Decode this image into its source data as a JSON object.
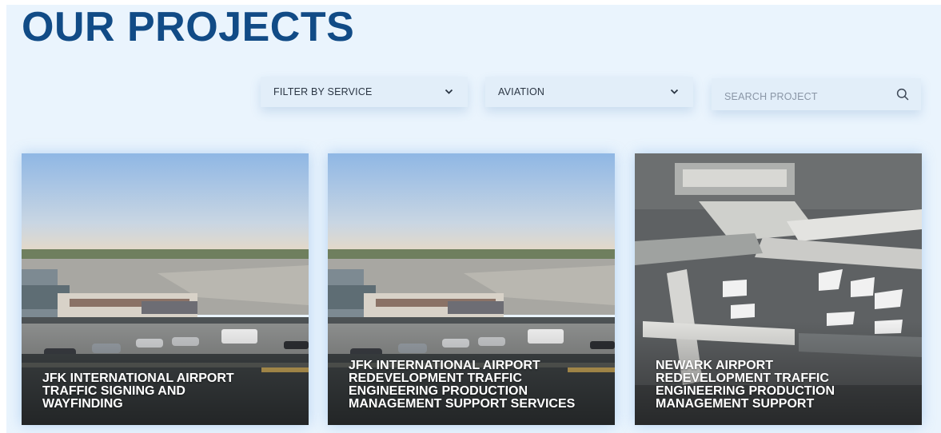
{
  "page": {
    "title": "OUR PROJECTS"
  },
  "filters": {
    "service": {
      "value": "FILTER BY SERVICE",
      "icon": "chevron-down-icon"
    },
    "category": {
      "value": "AVIATION",
      "icon": "chevron-down-icon"
    },
    "search": {
      "placeholder": "SEARCH PROJECT",
      "value": "",
      "icon": "search-icon"
    }
  },
  "projects": [
    {
      "title": "JFK INTERNATIONAL AIRPORT TRAFFIC SIGNING AND WAYFINDING"
    },
    {
      "title": "JFK INTERNATIONAL AIRPORT REDEVELOPMENT TRAFFIC ENGINEERING PRODUCTION MANAGEMENT SUPPORT SERVICES"
    },
    {
      "title": "NEWARK AIRPORT REDEVELOPMENT TRAFFIC ENGINEERING PRODUCTION MANAGEMENT SUPPORT"
    }
  ],
  "colors": {
    "brand": "#114b86",
    "background": "#eaf4fd",
    "control": "#e2eef9"
  }
}
